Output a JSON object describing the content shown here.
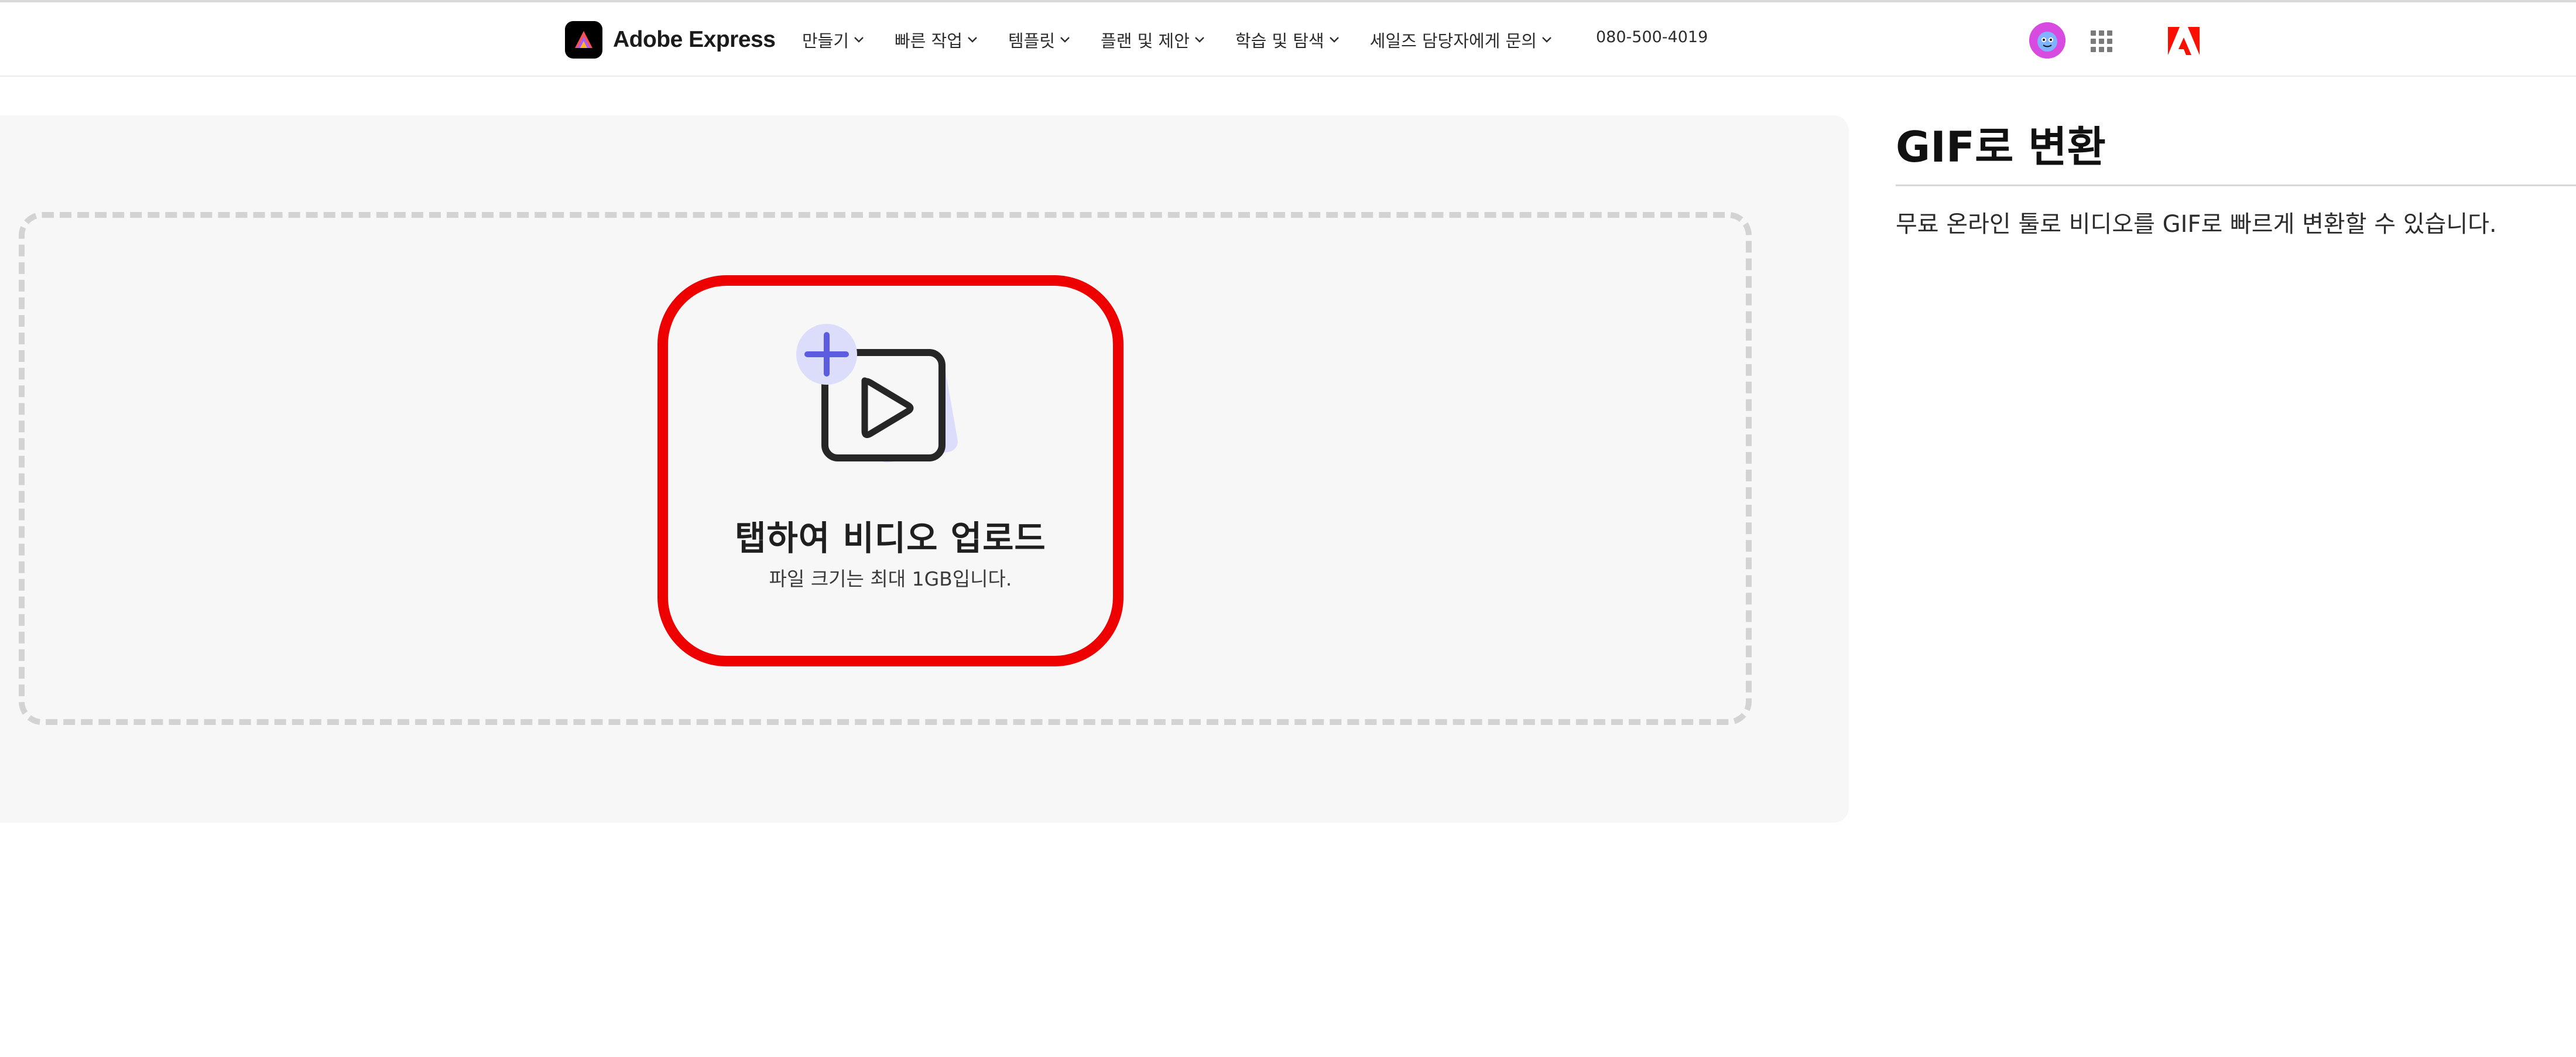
{
  "header": {
    "brand_name": "Adobe Express",
    "nav": [
      {
        "label": "만들기"
      },
      {
        "label": "빠른 작업"
      },
      {
        "label": "템플릿"
      },
      {
        "label": "플랜 및 제안"
      },
      {
        "label": "학습 및 탐색"
      },
      {
        "label": "세일즈 담당자에게 문의"
      }
    ],
    "phone": "080-500-4019",
    "icons": {
      "avatar": "user-avatar",
      "apps": "app-grid-icon",
      "adobe": "adobe-logo"
    }
  },
  "upload": {
    "title": "탭하여 비디오 업로드",
    "subtitle": "파일 크기는 최대 1GB입니다.",
    "icon": "video-add-icon"
  },
  "info": {
    "title": "GIF로 변환",
    "description": "무료 온라인 툴로 비디오를 GIF로 빠르게 변환할 수 있습니다."
  },
  "colors": {
    "highlight_border": "#ee0000",
    "panel_bg": "#f7f7f7",
    "dashed_border": "#d3d3d3",
    "icon_accent": "#5c5ce0",
    "icon_accent_light": "#dcdcfb",
    "adobe_red": "#fa0f00"
  }
}
